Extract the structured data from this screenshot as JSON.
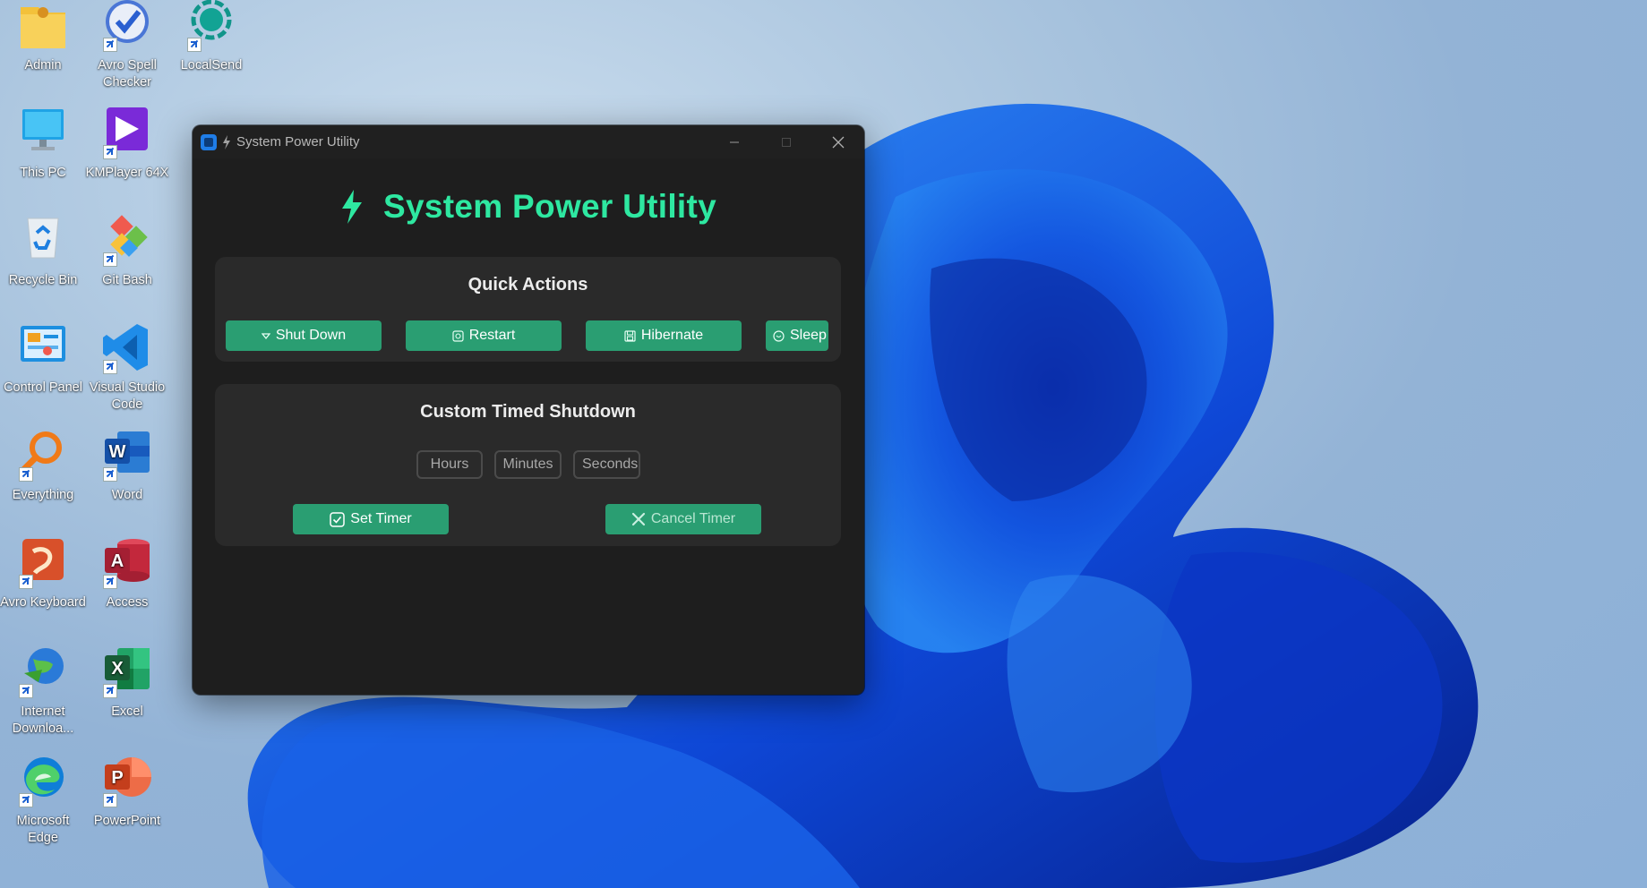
{
  "desktop": {
    "icons": [
      {
        "label": "Admin"
      },
      {
        "label": "Avro Spell Checker"
      },
      {
        "label": "LocalSend"
      },
      {
        "label": "This PC"
      },
      {
        "label": "KMPlayer 64X"
      },
      {
        "label": "Recycle Bin"
      },
      {
        "label": "Git Bash"
      },
      {
        "label": "Control Panel"
      },
      {
        "label": "Visual Studio Code"
      },
      {
        "label": "Everything"
      },
      {
        "label": "Word"
      },
      {
        "label": "Avro Keyboard"
      },
      {
        "label": "Access"
      },
      {
        "label": "Internet Downloa..."
      },
      {
        "label": "Excel"
      },
      {
        "label": "Microsoft Edge"
      },
      {
        "label": "PowerPoint"
      }
    ]
  },
  "window": {
    "title": "System Power Utility",
    "heading": "System Power Utility",
    "accent_color": "#2ee8a1",
    "button_color": "#2a9e72",
    "quick_actions": {
      "title": "Quick Actions",
      "buttons": [
        {
          "label": "Shut Down",
          "icon": "power-icon"
        },
        {
          "label": "Restart",
          "icon": "restart-icon"
        },
        {
          "label": "Hibernate",
          "icon": "save-icon"
        },
        {
          "label": "Sleep",
          "icon": "moon-icon"
        }
      ]
    },
    "timer": {
      "title": "Custom Timed Shutdown",
      "hours_placeholder": "Hours",
      "minutes_placeholder": "Minutes",
      "seconds_placeholder": "Seconds",
      "set_label": "Set Timer",
      "cancel_label": "Cancel Timer"
    }
  }
}
